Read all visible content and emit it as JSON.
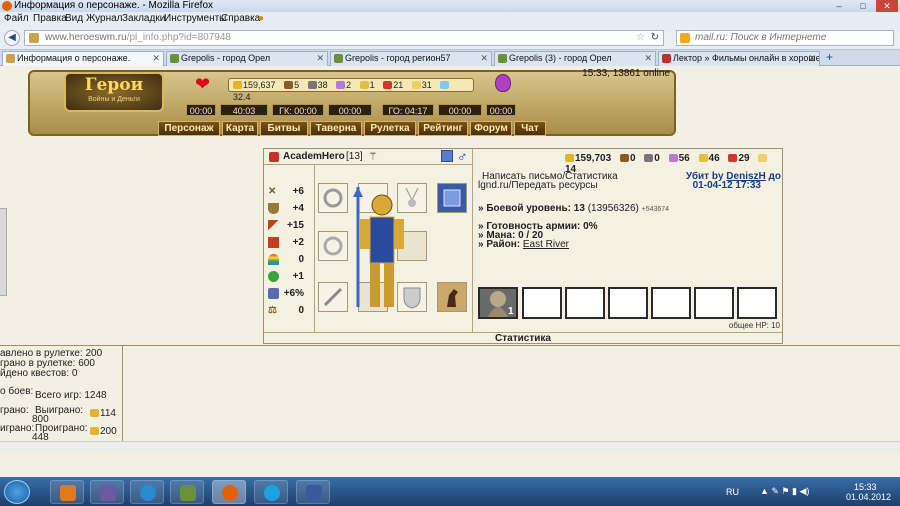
{
  "window": {
    "title": "Информация о персонаже. - Mozilla Firefox",
    "min": "–",
    "max": "□",
    "close": "✕"
  },
  "menu": [
    "Файл",
    "Правка",
    "Вид",
    "Журнал",
    "Закладки",
    "Инструменты",
    "Справка"
  ],
  "nav": {
    "back": "◀",
    "forward": "▶",
    "url_host": "www.heroeswm.ru",
    "url_path": "/pl_info.php?id=807948",
    "search_placeholder": "mail.ru: Поиск в Интернете",
    "new_tab": "+"
  },
  "tabs": [
    {
      "label": "Информация о персонаже.",
      "color": "#c9a24a"
    },
    {
      "label": "Grepolis - город Орел",
      "color": "#6b8f3a"
    },
    {
      "label": "Grepolis - город регион57",
      "color": "#6b8f3a"
    },
    {
      "label": "Grepolis (3) - город Орел",
      "color": "#6b8f3a"
    },
    {
      "label": "Лектор » Фильмы онлайн в хороше...",
      "color": "#b8322a"
    }
  ],
  "game": {
    "logo_title": "Герои",
    "logo_subtitle": "Войны и Деньги",
    "clock": "15:33, 13861 online",
    "resources": [
      "159,637",
      "5",
      "38",
      "2",
      "1",
      "21",
      "31",
      "32.4"
    ],
    "timers": [
      "00:00",
      "40:03",
      "ГК: 00:00",
      "00:00",
      "ГО: 04:17",
      "00:00",
      "00:00"
    ],
    "menu": [
      "Персонаж",
      "Карта",
      "Битвы",
      "Таверна",
      "Рулетка",
      "Рейтинг",
      "Форум",
      "Чат"
    ]
  },
  "character": {
    "name": "AcademHero",
    "level": "[13]",
    "stats": [
      {
        "icon": "swords-icon",
        "value": "+6"
      },
      {
        "icon": "shield-icon",
        "value": "+4"
      },
      {
        "icon": "wand-icon",
        "value": "+15"
      },
      {
        "icon": "book-icon",
        "value": "+2"
      },
      {
        "icon": "rainbow-icon",
        "value": "0"
      },
      {
        "icon": "luck-icon",
        "value": "+1"
      },
      {
        "icon": "potion-icon",
        "value": "+6%"
      },
      {
        "icon": "scales-icon",
        "value": "0"
      }
    ],
    "resources": [
      "159,703",
      "0",
      "0",
      "56",
      "46",
      "29",
      "14"
    ],
    "links": {
      "mail": "Написать письмо/Статистика",
      "transfer": "lgnd.ru/Передать ресурсы"
    },
    "killed_by": "Убит by",
    "killer": "DeniszH",
    "killed_to": "до",
    "killed_date": "01-04-12 17:33",
    "combat_label": "» Боевой уровень:",
    "combat_level": "13",
    "combat_exp": "(13956326)",
    "combat_extra": "+543674",
    "army_ready": "» Готовность армии: 0%",
    "mana": "» Мана: 0 / 20",
    "district_label": "» Район:",
    "district": "East River",
    "army_count": "1",
    "hp": "общее HP: 10",
    "stats_tab": "Статистика"
  },
  "stats_left": [
    "авлено в рулетке: 200",
    "грано в рулетке: 600",
    "йдено квестов: 0",
    "о боев:",
    "Всего игр: 1248",
    "грано:",
    "Выиграно:",
    "800",
    "114",
    "играно:",
    "Проиграно:",
    "448",
    "200"
  ],
  "taskbar": {
    "lang": "RU",
    "time": "15:33",
    "date": "01.04.2012"
  },
  "colors": {
    "gold": "#c9a24a",
    "dark_brown": "#4a300c",
    "link": "#1a3a8a"
  }
}
